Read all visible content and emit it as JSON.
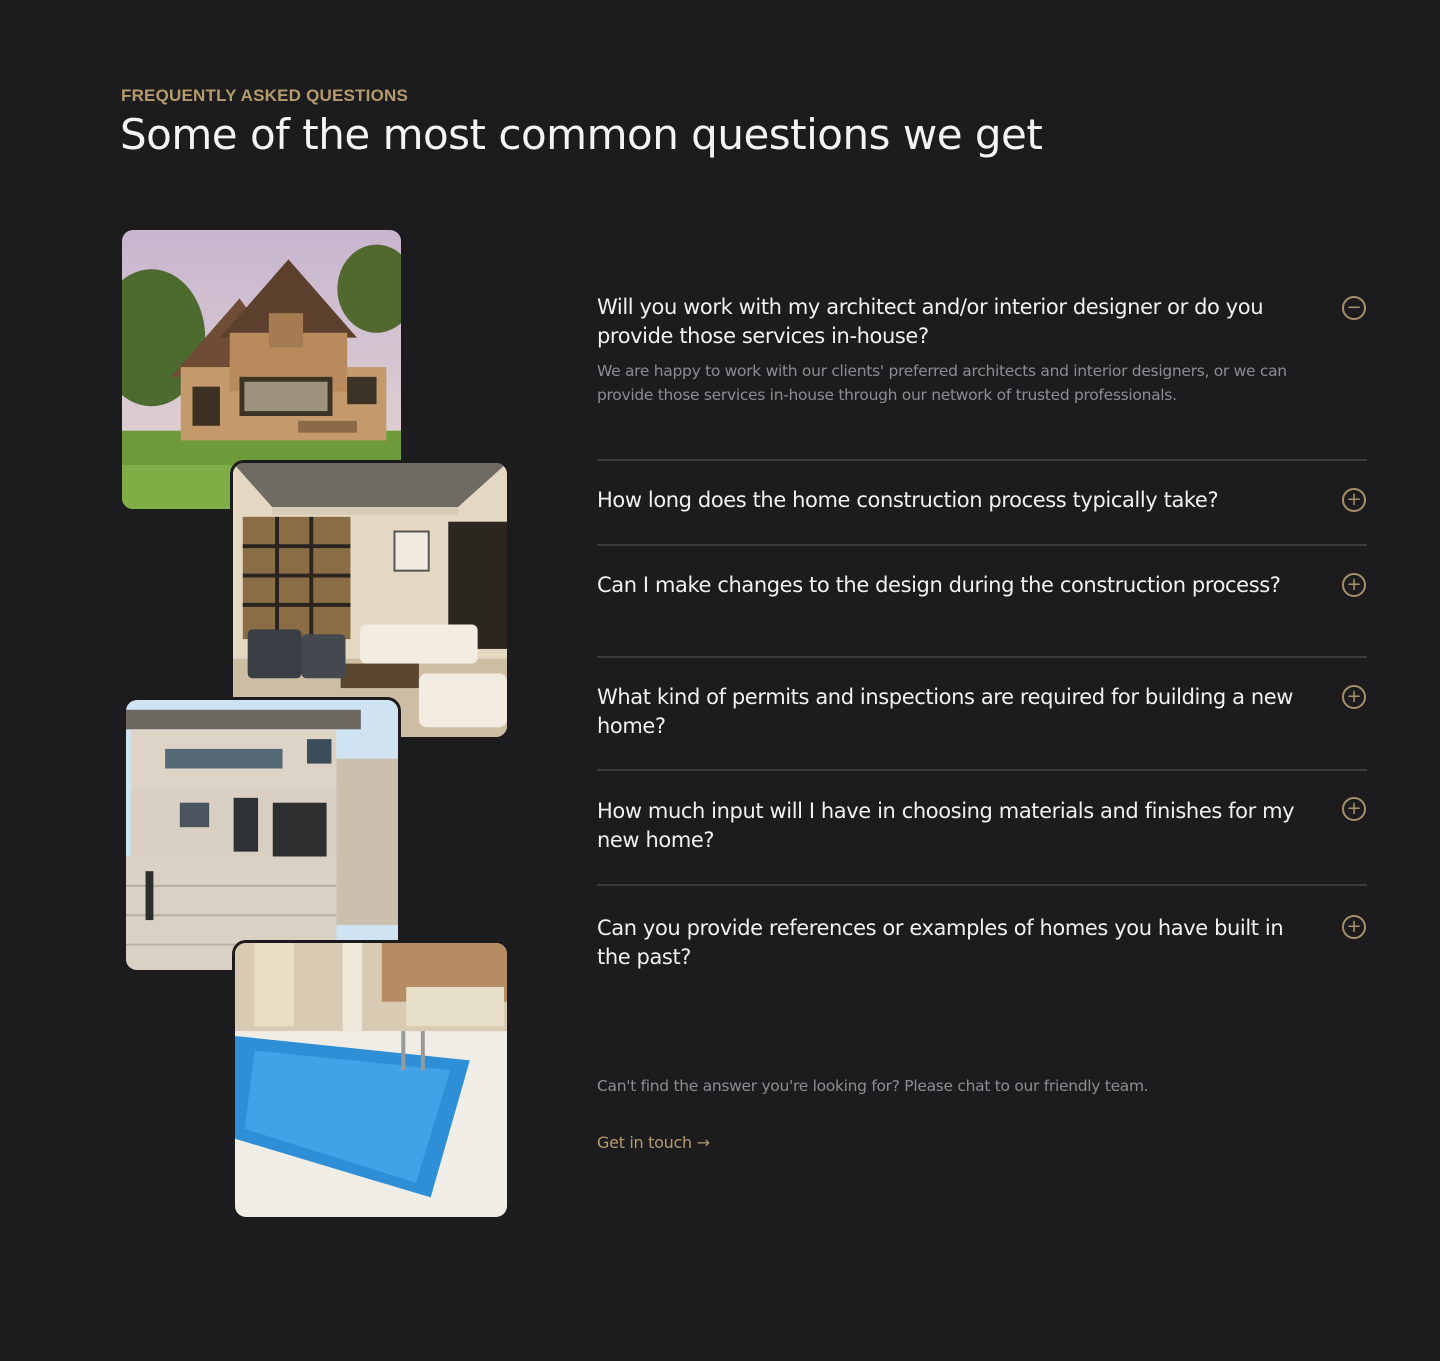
{
  "section": {
    "eyebrow": "FREQUENTLY ASKED QUESTIONS",
    "title": "Some of the most common questions we get"
  },
  "faq": {
    "items": [
      {
        "question": "Will you work with my architect and/or interior designer or do you provide those services in-house?",
        "answer": "We are happy to work with our clients' preferred architects and interior designers, or we can provide those services in-house through our network of trusted professionals.",
        "expanded": true,
        "icon": "minus-circle-icon"
      },
      {
        "question": "How long does the home construction process typically take?",
        "expanded": false,
        "icon": "plus-circle-icon"
      },
      {
        "question": "Can I make changes to the design during the construction process?",
        "expanded": false,
        "icon": "plus-circle-icon"
      },
      {
        "question": "What kind of permits and inspections are required for building a new home?",
        "expanded": false,
        "icon": "plus-circle-icon"
      },
      {
        "question": "How much input will I have in choosing materials and finishes for my new home?",
        "expanded": false,
        "icon": "plus-circle-icon"
      },
      {
        "question": "Can you provide references or examples of homes you have built in the past?",
        "expanded": false,
        "icon": "plus-circle-icon"
      }
    ]
  },
  "footer": {
    "text": "Can't find the answer you're looking for? Please chat to our friendly team.",
    "cta_label": "Get in touch →"
  },
  "colors": {
    "background": "#1c1c1e",
    "accent": "#b59a6c",
    "divider": "#3b3b3e"
  }
}
